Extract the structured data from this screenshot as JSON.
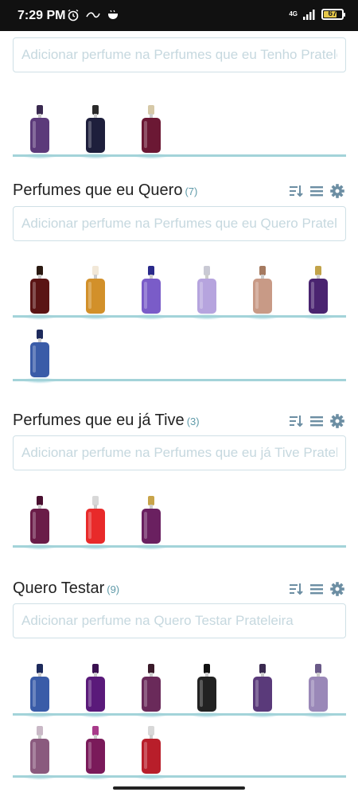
{
  "status_bar": {
    "time": "7:29 PM",
    "network": "4G",
    "battery": "67"
  },
  "top_section": {
    "placeholder": "Adicionar perfume na Perfumes que eu Tenho Prateleira",
    "rows": [
      [
        {
          "name": "tall-slim-purple-bottle-icon",
          "color": "#5c3a7a",
          "cap": "#3a2a50"
        },
        {
          "name": "dark-round-bottle-icon",
          "color": "#1e1f3c",
          "cap": "#2a2a2a"
        },
        {
          "name": "red-dark-bottle-icon",
          "color": "#6b1834",
          "cap": "#d6c9a8"
        }
      ]
    ]
  },
  "sections": [
    {
      "title": "Perfumes que eu Quero",
      "count": "(7)",
      "placeholder": "Adicionar perfume na Perfumes que eu Quero Prateleira",
      "rows": [
        [
          {
            "name": "dark-red-slim-bottle-icon",
            "color": "#5a1414",
            "cap": "#2b1a12"
          },
          {
            "name": "orange-spray-bottle-icon",
            "color": "#d2902a",
            "cap": "#f2e8d8"
          },
          {
            "name": "gradient-purple-orange-bottle-icon",
            "color": "#7a5cc8",
            "cap": "#2a2a8a"
          },
          {
            "name": "lilac-bottle-icon",
            "color": "#b6a4de",
            "cap": "#c9c9d4"
          },
          {
            "name": "rose-gold-ornate-bottle-icon",
            "color": "#c89a86",
            "cap": "#a57a60"
          },
          {
            "name": "purple-drop-bottle-icon",
            "color": "#4a2470",
            "cap": "#c2a34a"
          }
        ],
        [
          {
            "name": "blue-spray-bottle-icon",
            "color": "#3a5ca8",
            "cap": "#1d2a5c"
          }
        ]
      ]
    },
    {
      "title": "Perfumes que eu já Tive",
      "count": "(3)",
      "placeholder": "Adicionar perfume na Perfumes que eu já Tive Prateleira",
      "rows": [
        [
          {
            "name": "wine-square-bottle-icon",
            "color": "#6a1c48",
            "cap": "#4a1030"
          },
          {
            "name": "red-round-bottle-icon",
            "color": "#e82a2a",
            "cap": "#d8d8d8"
          },
          {
            "name": "purple-box-bottle-icon",
            "color": "#6a2060",
            "cap": "#c8a44a"
          }
        ]
      ]
    },
    {
      "title": "Quero Testar",
      "count": "(9)",
      "placeholder": "Adicionar perfume na Quero Testar Prateleira",
      "rows": [
        [
          {
            "name": "blue-spray-bottle-icon",
            "color": "#3a5ca8",
            "cap": "#1d2a5c"
          },
          {
            "name": "curved-purple-bottle-icon",
            "color": "#5a1a7a",
            "cap": "#3a1050"
          },
          {
            "name": "plum-square-bottle-icon",
            "color": "#6a2a5a",
            "cap": "#3a1a2a"
          },
          {
            "name": "black-slim-bottle-icon",
            "color": "#222222",
            "cap": "#111111"
          },
          {
            "name": "patterned-purple-bottle-icon",
            "color": "#5a3a7a",
            "cap": "#3a2a50"
          },
          {
            "name": "silver-lavender-bottle-icon",
            "color": "#9a88b8",
            "cap": "#6a5a88"
          }
        ],
        [
          {
            "name": "mauve-faceted-bottle-icon",
            "color": "#8a5a7e",
            "cap": "#c9b8c6"
          },
          {
            "name": "pink-tall-bottle-icon",
            "color": "#7a1a5a",
            "cap": "#a83a8a"
          },
          {
            "name": "red-hourglass-bottle-icon",
            "color": "#b81e2a",
            "cap": "#d8d8d8"
          }
        ]
      ]
    }
  ],
  "colors": {
    "accent": "#5f9aa8",
    "shelf": "#a3d3d9",
    "icon": "#6c8ea3"
  }
}
